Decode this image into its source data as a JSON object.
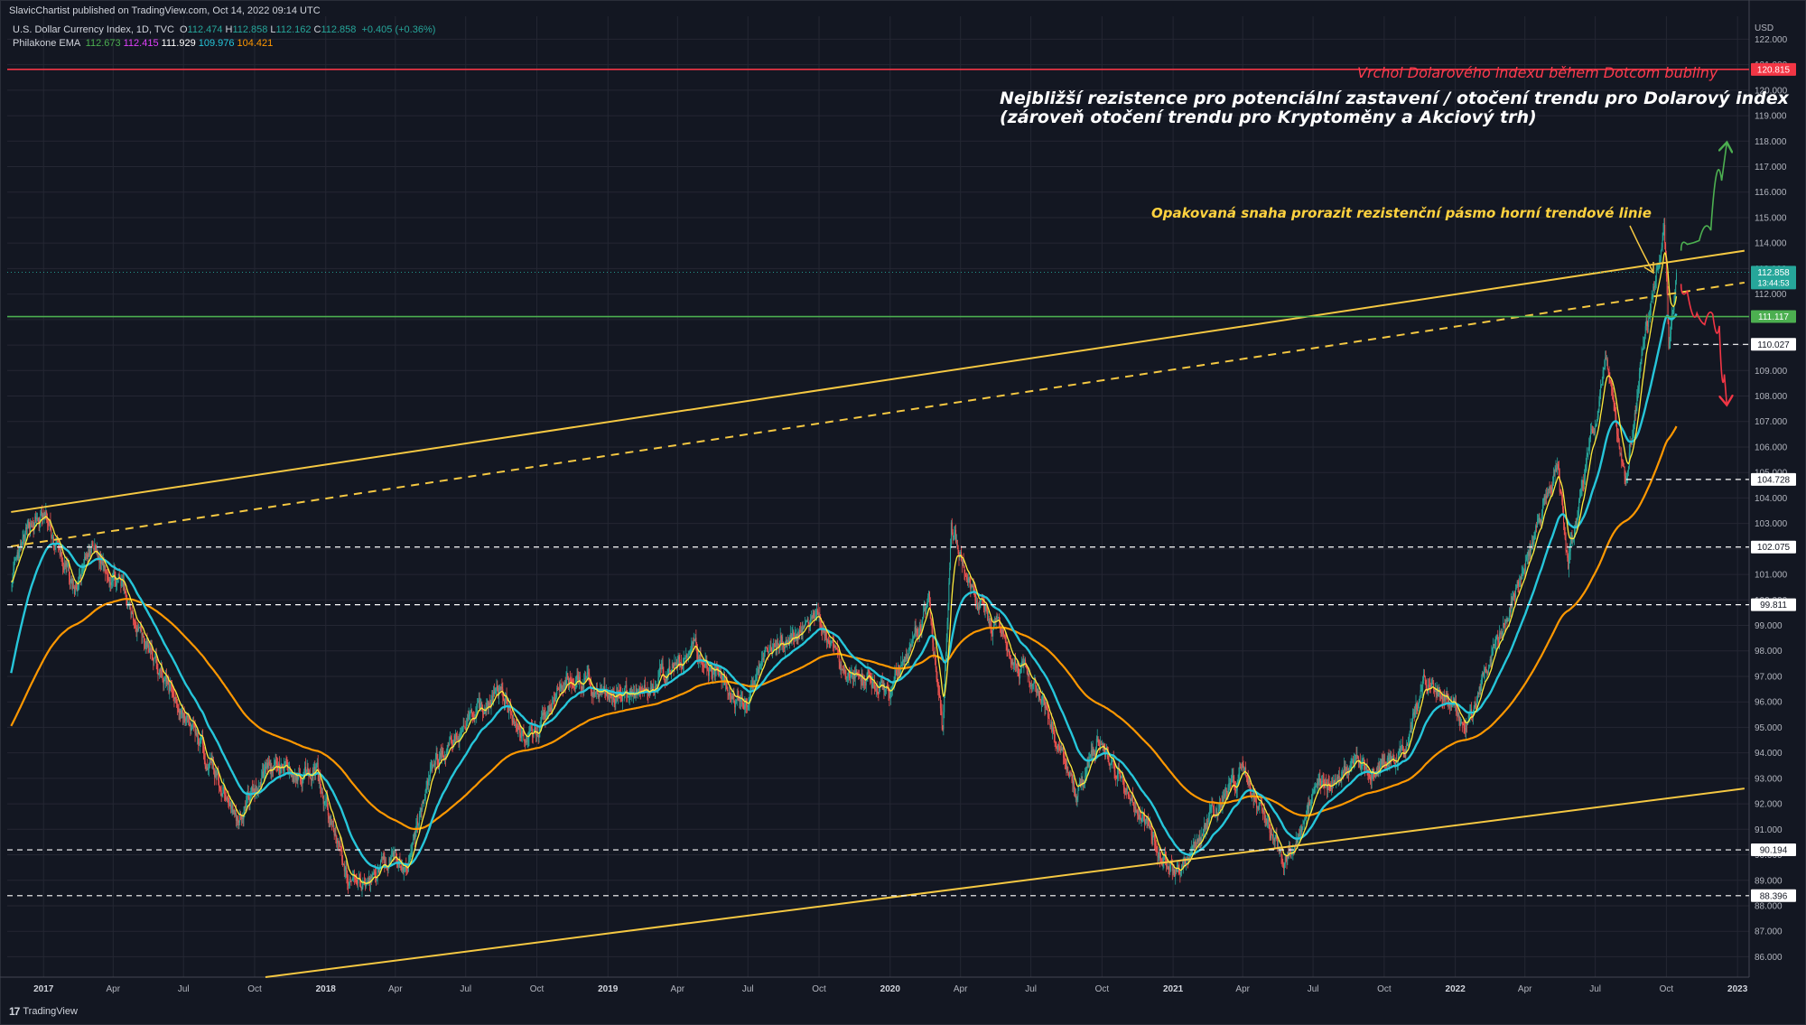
{
  "header": {
    "published": "SlavicChartist published on TradingView.com, Oct 14, 2022 09:14 UTC"
  },
  "legend": {
    "symbol": "U.S. Dollar Currency Index, 1D, TVC",
    "ohlc": [
      {
        "key": "O",
        "value": "112.474"
      },
      {
        "key": "H",
        "value": "112.858"
      },
      {
        "key": "L",
        "value": "112.162"
      },
      {
        "key": "C",
        "value": "112.858"
      }
    ],
    "change": "+0.405 (+0.36%)",
    "indicator": "Philakone EMA",
    "ema_values": [
      {
        "value": "112.673",
        "color": "#4caf50"
      },
      {
        "value": "112.415",
        "color": "#e040fb"
      },
      {
        "value": "111.929",
        "color": "#ffeb3b"
      },
      {
        "value": "109.976",
        "color": "#26c6da"
      },
      {
        "value": "104.421",
        "color": "#ff9800"
      }
    ]
  },
  "footer": {
    "logo": "17",
    "brand": "TradingView"
  },
  "annotations": {
    "dotcom": "Vrchol Dolarového indexu během Dotcom bubliny",
    "resistance_line1": "Nejbližší rezistence pro potenciální zastavení / otočení trendu pro Dolarový index",
    "resistance_line2": "(zároveň otočení trendu pro Kryptoměny a Akciový trh)",
    "attempt": "Opakovaná snaha prorazit rezistenční pásmo horní trendové linie"
  },
  "colors": {
    "background": "#131722",
    "up": "#26a69a",
    "down": "#ef5350",
    "ema_fast": "#ffeb3b",
    "ema_mid": "#26c6da",
    "ema_slow": "#ff9800",
    "trendline": "#f5c842",
    "red_line": "#f23645",
    "green_line": "#4caf50"
  },
  "chart_data": {
    "type": "candlestick",
    "currency": "USD",
    "ylim": [
      85.2,
      122.9
    ],
    "y_ticks": [
      86,
      87,
      88,
      89,
      90,
      91,
      92,
      93,
      94,
      95,
      96,
      97,
      98,
      99,
      100,
      101,
      102,
      103,
      104,
      105,
      106,
      107,
      108,
      109,
      110,
      111,
      112,
      113,
      114,
      115,
      116,
      117,
      118,
      119,
      120,
      121,
      122
    ],
    "x_ticks": [
      "2017",
      "Apr",
      "Jul",
      "Oct",
      "2018",
      "Apr",
      "Jul",
      "Oct",
      "2019",
      "Apr",
      "Jul",
      "Oct",
      "2020",
      "Apr",
      "Jul",
      "Oct",
      "2021",
      "Apr",
      "Jul",
      "Oct",
      "2022",
      "Apr",
      "Jul",
      "Oct",
      "2023"
    ],
    "grid": true,
    "price_path": [
      [
        "2016-11-20",
        100.6
      ],
      [
        "2016-12-15",
        103.0
      ],
      [
        "2017-01-03",
        103.2
      ],
      [
        "2017-02-10",
        100.3
      ],
      [
        "2017-03-05",
        102.0
      ],
      [
        "2017-04-15",
        100.4
      ],
      [
        "2017-05-20",
        97.8
      ],
      [
        "2017-07-01",
        95.5
      ],
      [
        "2017-08-15",
        93.0
      ],
      [
        "2017-09-08",
        91.4
      ],
      [
        "2017-10-20",
        93.6
      ],
      [
        "2017-11-25",
        93.0
      ],
      [
        "2017-12-20",
        93.5
      ],
      [
        "2018-01-25",
        89.3
      ],
      [
        "2018-02-16",
        88.6
      ],
      [
        "2018-03-20",
        89.8
      ],
      [
        "2018-04-16",
        89.5
      ],
      [
        "2018-05-20",
        93.6
      ],
      [
        "2018-06-28",
        95.0
      ],
      [
        "2018-08-15",
        96.5
      ],
      [
        "2018-09-20",
        94.3
      ],
      [
        "2018-11-12",
        97.0
      ],
      [
        "2018-12-31",
        96.2
      ],
      [
        "2019-02-20",
        96.5
      ],
      [
        "2019-04-25",
        98.0
      ],
      [
        "2019-06-25",
        95.7
      ],
      [
        "2019-07-25",
        97.8
      ],
      [
        "2019-10-01",
        99.3
      ],
      [
        "2019-11-01",
        97.3
      ],
      [
        "2019-12-31",
        96.4
      ],
      [
        "2020-02-20",
        99.8
      ],
      [
        "2020-03-09",
        94.7
      ],
      [
        "2020-03-20",
        102.8
      ],
      [
        "2020-04-20",
        100.0
      ],
      [
        "2020-05-30",
        98.3
      ],
      [
        "2020-07-15",
        96.0
      ],
      [
        "2020-08-30",
        92.3
      ],
      [
        "2020-09-25",
        94.5
      ],
      [
        "2020-10-25",
        93.1
      ],
      [
        "2020-12-15",
        90.1
      ],
      [
        "2021-01-06",
        89.4
      ],
      [
        "2021-03-31",
        93.3
      ],
      [
        "2021-05-25",
        89.7
      ],
      [
        "2021-07-07",
        92.6
      ],
      [
        "2021-08-20",
        93.5
      ],
      [
        "2021-09-20",
        93.3
      ],
      [
        "2021-10-28",
        94.2
      ],
      [
        "2021-11-24",
        96.9
      ],
      [
        "2022-01-01",
        95.7
      ],
      [
        "2022-01-14",
        94.8
      ],
      [
        "2022-03-07",
        99.2
      ],
      [
        "2022-04-28",
        103.9
      ],
      [
        "2022-05-13",
        105.0
      ],
      [
        "2022-05-27",
        101.6
      ],
      [
        "2022-07-14",
        109.3
      ],
      [
        "2022-08-10",
        104.7
      ],
      [
        "2022-08-29",
        109.2
      ],
      [
        "2022-09-28",
        114.8
      ],
      [
        "2022-10-04",
        110.1
      ],
      [
        "2022-10-14",
        112.86
      ]
    ],
    "levels": [
      {
        "value": 120.815,
        "label": "120.815",
        "style": "solid",
        "color": "#f23645"
      },
      {
        "value": 111.117,
        "label": "111.117",
        "style": "solid",
        "color": "#4caf50"
      },
      {
        "value": 110.027,
        "label": "110.027",
        "style": "dashed",
        "color": "#ffffff",
        "from": "2022-10-10"
      },
      {
        "value": 104.728,
        "label": "104.728",
        "style": "dashed",
        "color": "#ffffff",
        "from": "2022-08-10"
      },
      {
        "value": 102.075,
        "label": "102.075",
        "style": "dashed",
        "color": "#ffffff"
      },
      {
        "value": 99.811,
        "label": "99.811",
        "style": "dashed",
        "color": "#ffffff"
      },
      {
        "value": 90.194,
        "label": "90.194",
        "style": "dashed",
        "color": "#ffffff"
      },
      {
        "value": 88.396,
        "label": "88.396",
        "style": "dashed",
        "color": "#ffffff"
      }
    ],
    "last_price": {
      "label": "112.858",
      "countdown": "13:44:53"
    },
    "trendlines": [
      {
        "from": [
          "2016-11-20",
          103.45
        ],
        "to": [
          "2023-01-10",
          113.7
        ],
        "style": "solid"
      },
      {
        "from": [
          "2016-11-20",
          102.1
        ],
        "to": [
          "2023-01-10",
          112.45
        ],
        "style": "dashed"
      },
      {
        "from": [
          "2017-10-15",
          85.2
        ],
        "to": [
          "2023-01-10",
          92.6
        ],
        "style": "solid"
      }
    ],
    "arrows": [
      {
        "color": "#4caf50",
        "points": [
          [
            "2022-10-20",
            113.7
          ],
          [
            "2022-11-05",
            114.2
          ],
          [
            "2022-11-20",
            114.0
          ],
          [
            "2022-12-05",
            115.0
          ],
          [
            "2022-12-18",
            117.9
          ]
        ]
      },
      {
        "color": "#f23645",
        "points": [
          [
            "2022-10-20",
            112.4
          ],
          [
            "2022-11-05",
            111.8
          ],
          [
            "2022-11-14",
            110.7
          ],
          [
            "2022-11-25",
            110.9
          ],
          [
            "2022-12-05",
            111.5
          ],
          [
            "2022-12-12",
            110.0
          ],
          [
            "2022-12-18",
            107.7
          ]
        ]
      }
    ],
    "forecast_start": "2022-10-18"
  }
}
